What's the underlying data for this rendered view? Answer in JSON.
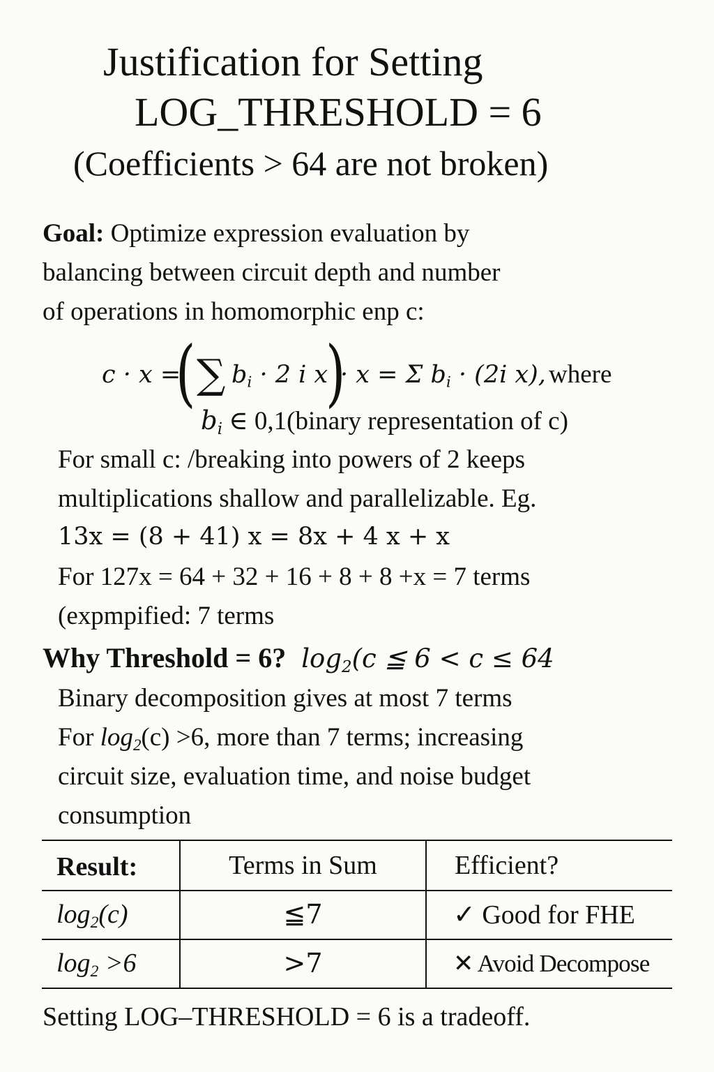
{
  "title": {
    "line1": "Justification for Setting",
    "line2": "LOG_THRESHOLD = 6",
    "line3": "(Coefficients > 64 are not broken)"
  },
  "goal": {
    "label": "Goal:",
    "line1": "Optimize expression evaluation by",
    "line2": "balancing between circuit depth and number",
    "line3": "of operations in homomorphic enp c:"
  },
  "formula": {
    "lhs": "c · x =",
    "inner": "b",
    "inner_sub": "i",
    "inner_rest": " · 2  i x",
    "middle": "· x = Σ b",
    "middle_sub": "i",
    "middle_rest": " · (2i x),",
    "where": "where",
    "cond_var": "b",
    "cond_sub": "i",
    "cond_rest": " ∈ 0,1(binary representation of c)"
  },
  "small_c": {
    "line1": "For small c: /breaking into powers of 2 keeps",
    "line2": "multiplications shallow and parallelizable.  Eg.",
    "line3": "13x = (8 + 41) x = 8x + 4 x + x",
    "line4": "For 127x = 64 + 32 + 16 + 8 + 8 +x = 7 terms",
    "line5": "(expmpified: 7 terms"
  },
  "why": {
    "label": "Why Threshold = 6?",
    "expr": "log",
    "expr_sub": "2",
    "expr_rest": "(c ≦ 6 < c ≤ 64",
    "line1": "Binary decomposition gives at most 7 terms",
    "line2_pre": "For",
    "line2_log": "log",
    "line2_sub": "2",
    "line2_rest": "(c) >6, more than 7 terms; increasing",
    "line3": "circuit size, evaluation time, and noise budget",
    "line4": "consumption"
  },
  "table": {
    "headers": [
      "Result:",
      "Terms in Sum",
      "Efficient?"
    ],
    "rows": [
      {
        "result_log": "log",
        "result_sub": "2",
        "result_rest": "(c)",
        "terms": "≦7",
        "mark": "✓",
        "efficient": "Good for FHE"
      },
      {
        "result_log": "log",
        "result_sub": "2",
        "result_rest": " >6",
        "terms": ">7",
        "mark": "✕",
        "efficient": "Avoid Decompose"
      }
    ]
  },
  "footer": "Setting LOG–THRESHOLD = 6 is a tradeoff."
}
